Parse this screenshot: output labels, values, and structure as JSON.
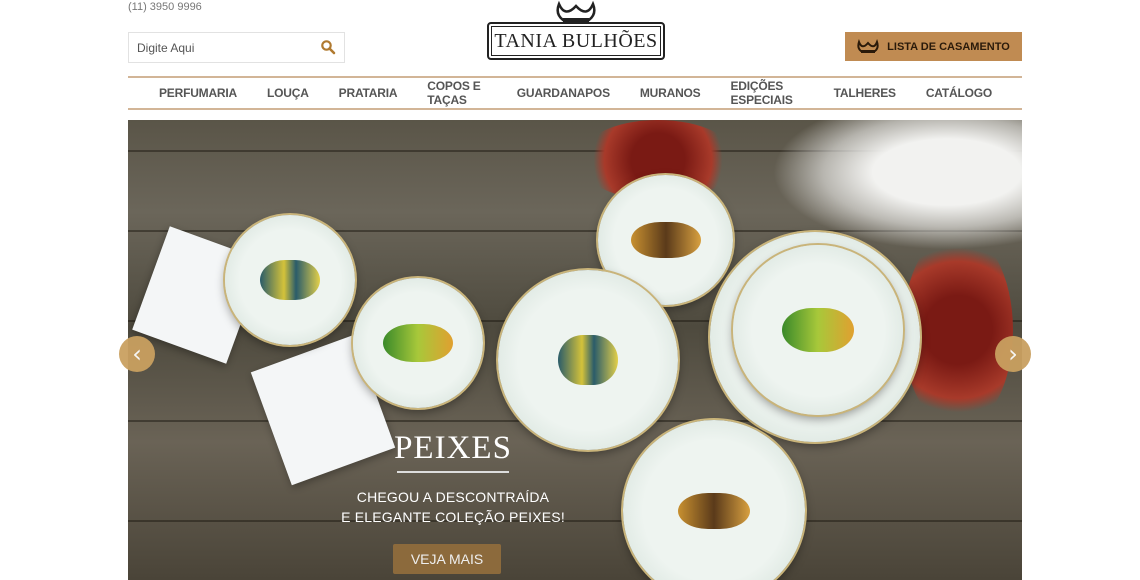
{
  "header": {
    "phone": "(11) 3950 9996",
    "search_placeholder": "Digite Aqui",
    "logo_text": "TANIA BULHÕES",
    "wedding_list_label": "LISTA DE CASAMENTO"
  },
  "nav": {
    "items": [
      {
        "label": "PERFUMARIA"
      },
      {
        "label": "LOUÇA"
      },
      {
        "label": "PRATARIA"
      },
      {
        "label": "COPOS E TAÇAS"
      },
      {
        "label": "GUARDANAPOS"
      },
      {
        "label": "MURANOS"
      },
      {
        "label": "EDIÇÕES ESPECIAIS"
      },
      {
        "label": "TALHERES"
      },
      {
        "label": "CATÁLOGO"
      }
    ]
  },
  "hero": {
    "title": "PEIXES",
    "line1": "CHEGOU A DESCONTRAÍDA",
    "line2": "E ELEGANTE COLEÇÃO PEIXES!",
    "cta": "VEJA MAIS",
    "prev_icon": "chevron-left-icon",
    "next_icon": "chevron-right-icon"
  },
  "colors": {
    "accent": "#c08b52",
    "nav_border": "#d2b597",
    "cta": "#8c6a3c"
  }
}
